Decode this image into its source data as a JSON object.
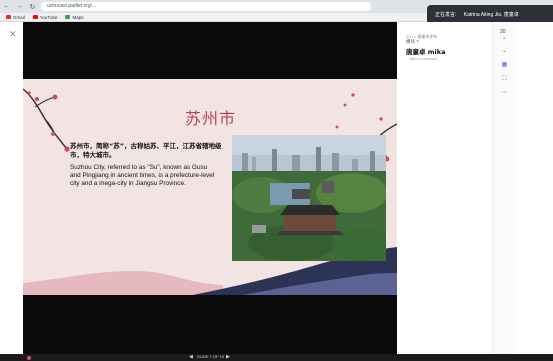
{
  "browser": {
    "url": "uchuusei.padlet.org/...",
    "back_icon": "back-arrow-icon",
    "forward_icon": "forward-arrow-icon",
    "reload_icon": "reload-icon",
    "bookmarks": [
      {
        "label": "Gmail",
        "color": "#d93025"
      },
      {
        "label": "YouTube",
        "color": "#ff0000"
      },
      {
        "label": "Maps",
        "color": "#34a853"
      }
    ]
  },
  "presenter_banner": {
    "prefix": "正在发言:",
    "names": "Katrina Aiting Jia, 唐童卓"
  },
  "slide": {
    "title": "苏州市",
    "cn_text": "苏州市，简称“苏”，古称姑苏、平江，江苏省辖地级市，特大城市。",
    "en_text": "Suzhou City, referred to as \"Su\", known as Gusu and Pingjiang in ancient times, is a prefecture-level city and a mega-city in Jiangsu Province.",
    "counter": "SLIDE 7 OF 10"
  },
  "panel": {
    "meta": "1/17 • 唐童卓发布",
    "section": "模块 7",
    "title": "唐童卓 mika",
    "input_placeholder": "Add a comment"
  },
  "rail": {
    "count": "20"
  },
  "colors": {
    "accent_red": "#b64450",
    "slide_bg": "#f3e4e4",
    "rail_blue": "#4a68d8"
  }
}
